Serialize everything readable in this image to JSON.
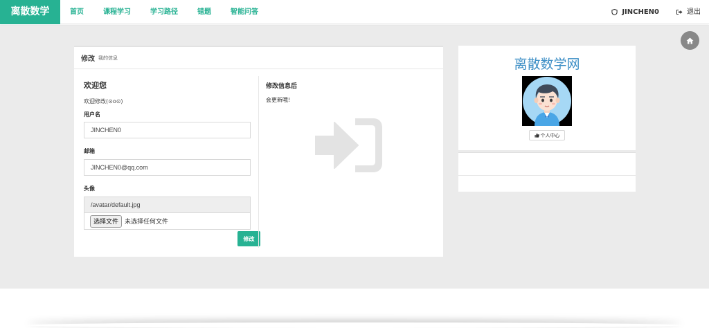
{
  "navbar": {
    "brand": "离散数学",
    "links": [
      "首页",
      "课程学习",
      "学习路径",
      "错题",
      "智能问答"
    ],
    "user": "JINCHEN0",
    "logout": "退出"
  },
  "panel": {
    "title": "修改",
    "subtitle": "我的信息",
    "welcome": "欢迎您",
    "welcome_text": "欢迎修改(⊙o⊙)",
    "username_label": "用户名",
    "username_value": "JINCHEN0",
    "email_label": "邮箱",
    "email_value": "JINCHEN0@qq.com",
    "avatar_label": "头像",
    "avatar_path": "/avatar/default.jpg",
    "file_button": "选择文件",
    "file_status": "未选择任何文件",
    "submit": "修改",
    "after_title": "修改信息后",
    "after_text": "会更新哦!"
  },
  "side": {
    "site_title": "离散数学网",
    "profile_button": "个人中心"
  },
  "colors": {
    "accent": "#27b293",
    "site_title": "#3e8fc6",
    "background": "#ebebeb"
  },
  "icons": {
    "nav_user": "shield-icon",
    "nav_logout": "logout-icon",
    "home": "home-icon",
    "sign_in": "sign-in-icon",
    "thumbs_up": "thumbs-up-icon"
  }
}
